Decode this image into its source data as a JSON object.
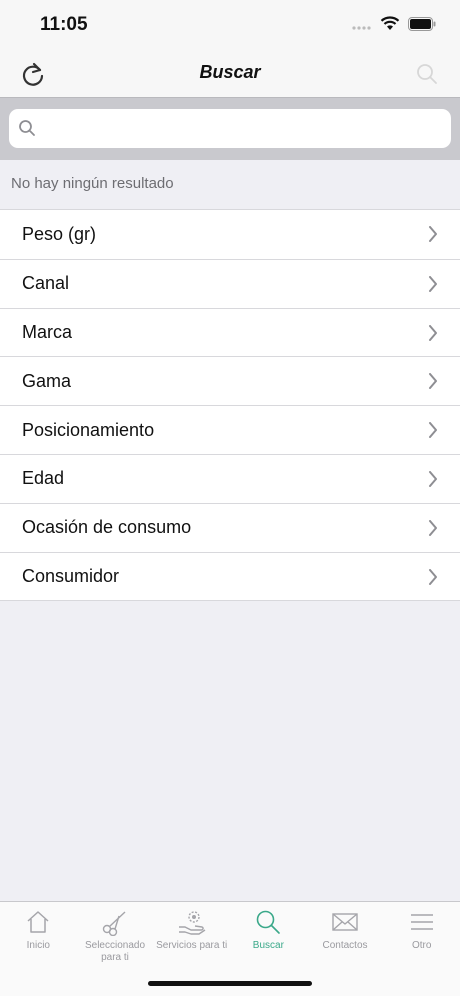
{
  "status_bar": {
    "time": "11:05"
  },
  "nav": {
    "title": "Buscar",
    "refresh_icon": "refresh-icon",
    "search_icon": "search-icon"
  },
  "search": {
    "placeholder": "",
    "value": ""
  },
  "no_results_text": "No hay ningún resultado",
  "filters": [
    {
      "label": "Peso (gr)"
    },
    {
      "label": "Canal"
    },
    {
      "label": "Marca"
    },
    {
      "label": "Gama"
    },
    {
      "label": "Posicionamiento"
    },
    {
      "label": "Edad"
    },
    {
      "label": "Ocasión de consumo"
    },
    {
      "label": "Consumidor"
    }
  ],
  "tabs": [
    {
      "label": "Inicio",
      "icon": "home-icon"
    },
    {
      "label": "Seleccionado para ti",
      "icon": "scissors-icon"
    },
    {
      "label": "Servicios para ti",
      "icon": "hand-gear-icon"
    },
    {
      "label": "Buscar",
      "icon": "search-icon",
      "active": true
    },
    {
      "label": "Contactos",
      "icon": "envelope-icon"
    },
    {
      "label": "Otro",
      "icon": "menu-icon"
    }
  ],
  "colors": {
    "accent": "#3aa889",
    "inactive": "#9a9a9f"
  }
}
